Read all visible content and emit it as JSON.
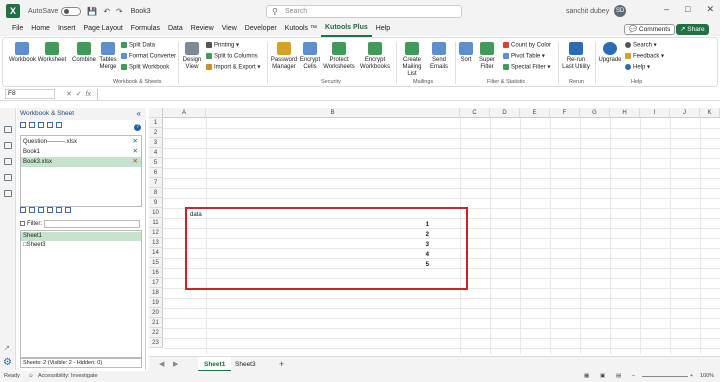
{
  "titlebar": {
    "autosave_label": "AutoSave",
    "autosave_state": "Off",
    "doc_name": "Book3",
    "search_placeholder": "Search",
    "user_name": "sanchit dubey",
    "user_initials": "SD"
  },
  "menu": {
    "tabs": [
      "File",
      "Home",
      "Insert",
      "Page Layout",
      "Formulas",
      "Data",
      "Review",
      "View",
      "Developer",
      "Kutools ™",
      "Kutools Plus",
      "Help"
    ],
    "active_tab": "Kutools Plus",
    "comments_label": "Comments",
    "share_label": "Share"
  },
  "ribbon": {
    "workbook": "Workbook",
    "worksheet": "Worksheet",
    "combine": "Combine",
    "tables_merge": "Tables Merge",
    "split_data": "Split Data",
    "format_converter": "Format Converter",
    "split_workbook": "Split Workbook",
    "design_view": "Design View",
    "printing": "Printing",
    "split_to_columns": "Split to Columns",
    "import_export": "Import & Export",
    "password_manager": "Password Manager",
    "encrypt_cells": "Encrypt Cells",
    "protect_worksheets": "Protect Worksheets",
    "encrypt_workbooks": "Encrypt Workbooks",
    "create_mailing_list": "Create Mailing List",
    "send_emails": "Send Emails",
    "sort": "Sort",
    "super_filter": "Super Filter",
    "count_by_color": "Count by Color",
    "pivot_table": "Pivot Table",
    "special_filter": "Special Filter",
    "rerun_last_utility": "Re-run Last Utility",
    "upgrade": "Upgrade",
    "search": "Search",
    "feedback": "Feedback",
    "help": "Help",
    "group_workbook_sheets": "Workbook & Sheets",
    "group_security": "Security",
    "group_mailings": "Mailings",
    "group_filter_statistic": "Filter & Statistic",
    "group_rerun": "Rerun",
    "group_help": "Help"
  },
  "formula_bar": {
    "name_box": "F8",
    "fx": "fx"
  },
  "pane": {
    "title": "Workbook & Sheet",
    "workbooks": [
      "Question---------.xlsx",
      "Book1",
      "Book3.xlsx"
    ],
    "selected_workbook": "Book3.xlsx",
    "filter_label": "Filter:",
    "sheets": [
      "Sheet1",
      "Sheet3"
    ],
    "selected_sheet": "Sheet1",
    "status": "Sheets: 2  (Visible: 2 - Hidden: 0)"
  },
  "grid": {
    "columns": [
      "A",
      "B",
      "C",
      "D",
      "E",
      "F",
      "G",
      "H",
      "I",
      "J",
      "K"
    ],
    "rows": [
      "1",
      "2",
      "3",
      "4",
      "5",
      "6",
      "7",
      "8",
      "9",
      "10",
      "11",
      "12",
      "13",
      "14",
      "15",
      "16",
      "17",
      "18",
      "19",
      "20",
      "21",
      "22",
      "23",
      "24"
    ],
    "header_cell": "data",
    "values": [
      "1",
      "2",
      "3",
      "4",
      "5"
    ]
  },
  "sheet_tabs": {
    "tabs": [
      "Sheet1",
      "Sheet3"
    ],
    "active": "Sheet1",
    "add": "+"
  },
  "statusbar": {
    "ready": "Ready",
    "accessibility": "Accessibility: Investigate",
    "zoom": "100%"
  },
  "colors": {
    "accent": "#1f7244",
    "highlight_box": "#c8262c",
    "selection": "#c5e3cc"
  }
}
